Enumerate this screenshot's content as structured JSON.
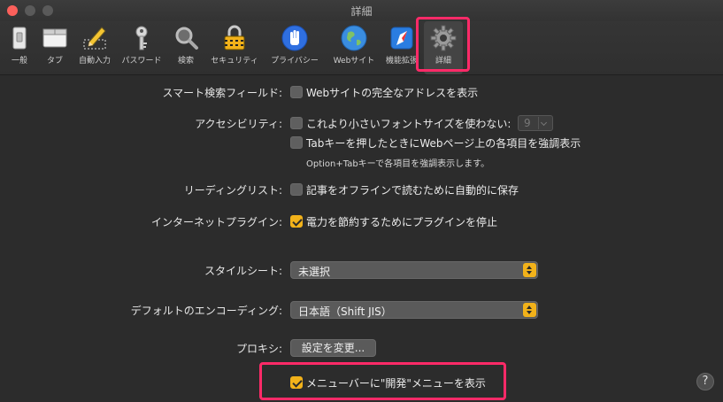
{
  "window": {
    "title": "詳細"
  },
  "toolbar": {
    "items": [
      {
        "label": "一般",
        "icon": "general-switch-icon"
      },
      {
        "label": "タブ",
        "icon": "tabs-icon"
      },
      {
        "label": "自動入力",
        "icon": "autofill-pencil-icon"
      },
      {
        "label": "パスワード",
        "icon": "key-icon"
      },
      {
        "label": "検索",
        "icon": "magnifier-icon"
      },
      {
        "label": "セキュリティ",
        "icon": "lock-icon"
      },
      {
        "label": "プライバシー",
        "icon": "hand-icon"
      },
      {
        "label": "Webサイト",
        "icon": "globe-icon"
      },
      {
        "label": "機能拡張",
        "icon": "extensions-icon"
      },
      {
        "label": "詳細",
        "icon": "gear-icon"
      }
    ]
  },
  "settings": {
    "smart_search": {
      "label": "スマート検索フィールド:",
      "option": "Webサイトの完全なアドレスを表示",
      "checked": false
    },
    "accessibility": {
      "label": "アクセシビリティ:",
      "option1": "これより小さいフォントサイズを使わない:",
      "option1_checked": false,
      "font_size": "9",
      "option2": "Tabキーを押したときにWebページ上の各項目を強調表示",
      "option2_checked": false,
      "hint": "Option+Tabキーで各項目を強調表示します。"
    },
    "reading_list": {
      "label": "リーディングリスト:",
      "option": "記事をオフラインで読むために自動的に保存",
      "checked": false
    },
    "plugins": {
      "label": "インターネットプラグイン:",
      "option": "電力を節約するためにプラグインを停止",
      "checked": true
    },
    "stylesheet": {
      "label": "スタイルシート:",
      "value": "未選択"
    },
    "encoding": {
      "label": "デフォルトのエンコーディング:",
      "value": "日本語（Shift JIS）"
    },
    "proxies": {
      "label": "プロキシ:",
      "button": "設定を変更..."
    },
    "develop_menu": {
      "option": "メニューバーに\"開発\"メニューを表示",
      "checked": true
    }
  },
  "help": {
    "label": "?"
  },
  "colors": {
    "accent": "#f2b21a",
    "highlight": "#ff2a68",
    "close": "#fc605b"
  }
}
